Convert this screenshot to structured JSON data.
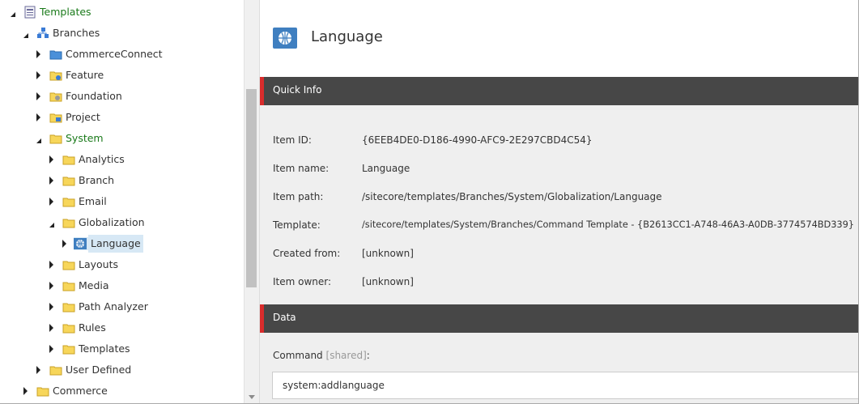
{
  "tree": {
    "items": [
      {
        "label": "Templates",
        "icon": "template-folder-icon",
        "expander": "open",
        "green": true
      },
      {
        "label": "Branches",
        "icon": "branches-icon",
        "expander": "open",
        "green": false
      },
      {
        "label": "CommerceConnect",
        "icon": "commerce-folder-icon",
        "expander": "closed",
        "green": false
      },
      {
        "label": "Feature",
        "icon": "feature-folder-icon",
        "expander": "closed",
        "green": false
      },
      {
        "label": "Foundation",
        "icon": "foundation-folder-icon",
        "expander": "closed",
        "green": false
      },
      {
        "label": "Project",
        "icon": "project-folder-icon",
        "expander": "closed",
        "green": false
      },
      {
        "label": "System",
        "icon": "folder-icon",
        "expander": "open",
        "green": true
      },
      {
        "label": "Analytics",
        "icon": "folder-icon",
        "expander": "closed",
        "green": false
      },
      {
        "label": "Branch",
        "icon": "folder-icon",
        "expander": "closed",
        "green": false
      },
      {
        "label": "Email",
        "icon": "folder-icon",
        "expander": "closed",
        "green": false
      },
      {
        "label": "Globalization",
        "icon": "folder-icon",
        "expander": "open",
        "green": false
      },
      {
        "label": "Language",
        "icon": "globe-icon",
        "expander": "closed",
        "green": false,
        "selected": true
      },
      {
        "label": "Layouts",
        "icon": "folder-icon",
        "expander": "closed",
        "green": false
      },
      {
        "label": "Media",
        "icon": "folder-icon",
        "expander": "closed",
        "green": false
      },
      {
        "label": "Path Analyzer",
        "icon": "folder-icon",
        "expander": "closed",
        "green": false
      },
      {
        "label": "Rules",
        "icon": "folder-icon",
        "expander": "closed",
        "green": false
      },
      {
        "label": "Templates",
        "icon": "folder-icon",
        "expander": "closed",
        "green": false
      },
      {
        "label": "User Defined",
        "icon": "folder-icon",
        "expander": "closed",
        "green": false
      },
      {
        "label": "Commerce",
        "icon": "folder-icon",
        "expander": "closed",
        "green": false
      }
    ]
  },
  "item": {
    "title": "Language",
    "icon": "globe-icon"
  },
  "quick_info": {
    "title": "Quick Info",
    "rows": [
      {
        "label": "Item ID:",
        "value": "{6EEB4DE0-D186-4990-AFC9-2E297CBD4C54}"
      },
      {
        "label": "Item name:",
        "value": "Language"
      },
      {
        "label": "Item path:",
        "value": "/sitecore/templates/Branches/System/Globalization/Language"
      },
      {
        "label": "Template:",
        "value": "/sitecore/templates/System/Branches/Command Template - {B2613CC1-A748-46A3-A0DB-3774574BD339}"
      },
      {
        "label": "Created from:",
        "value": "[unknown]"
      },
      {
        "label": "Item owner:",
        "value": "[unknown]"
      }
    ]
  },
  "data_section": {
    "title": "Data",
    "command_label": "Command",
    "shared_label": "[shared]",
    "label_colon": ":",
    "command_value": "system:addlanguage"
  },
  "colors": {
    "section_bar": "#474747",
    "section_accent": "#d92c2c",
    "green_text": "#1a7a1a",
    "selected_bg": "#d7e8f5",
    "icon_blue": "#3f7fc0"
  }
}
